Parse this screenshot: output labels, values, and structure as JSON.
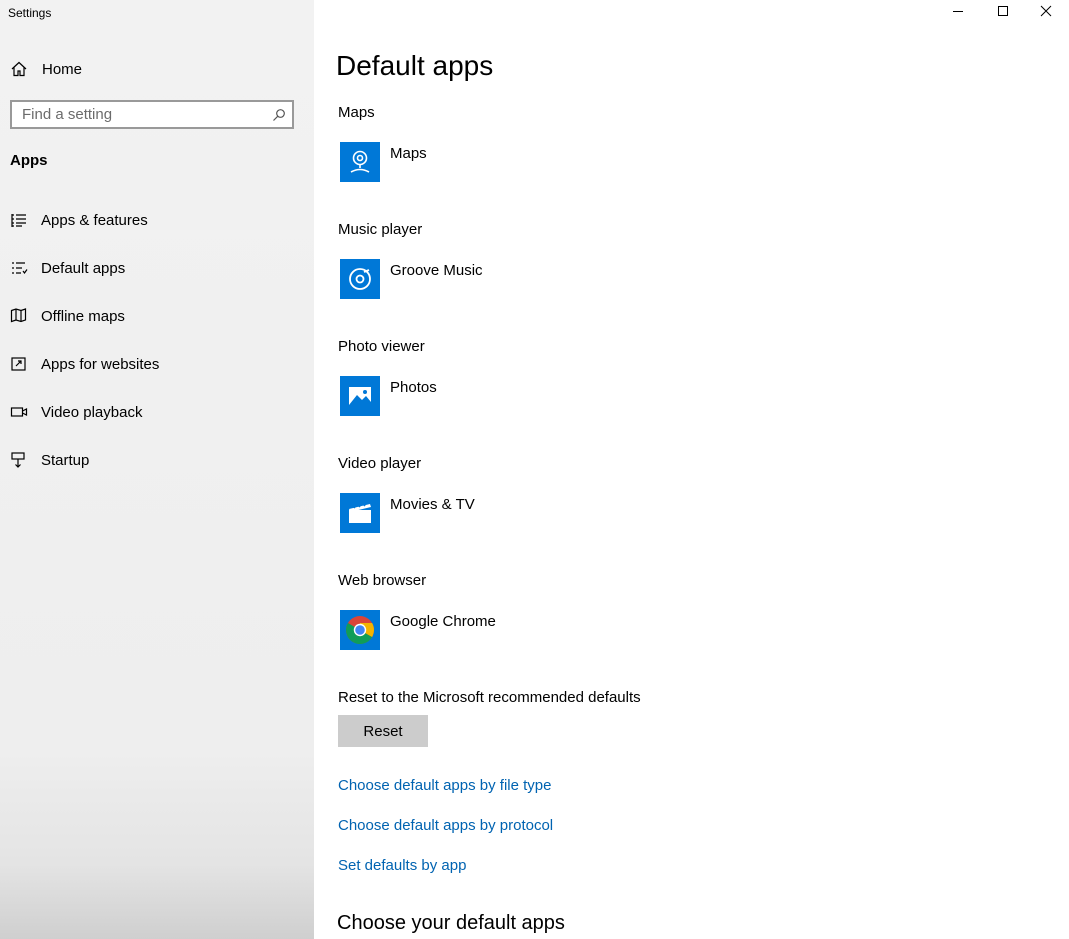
{
  "window": {
    "title": "Settings",
    "controls": [
      {
        "name": "minimize-button",
        "icon": "minimize-icon"
      },
      {
        "name": "maximize-button",
        "icon": "maximize-icon"
      },
      {
        "name": "close-button",
        "icon": "close-icon"
      }
    ]
  },
  "sidebar": {
    "home_label": "Home",
    "search_placeholder": "Find a setting",
    "section": "Apps",
    "items": [
      {
        "label": "Apps & features",
        "icon": "list-icon"
      },
      {
        "label": "Default apps",
        "icon": "default-apps-icon"
      },
      {
        "label": "Offline maps",
        "icon": "offline-maps-icon"
      },
      {
        "label": "Apps for websites",
        "icon": "apps-for-websites-icon"
      },
      {
        "label": "Video playback",
        "icon": "video-playback-icon"
      },
      {
        "label": "Startup",
        "icon": "startup-icon"
      }
    ]
  },
  "main": {
    "title": "Default apps",
    "groups": [
      {
        "label": "Maps",
        "app": "Maps",
        "icon": "maps-app-icon"
      },
      {
        "label": "Music player",
        "app": "Groove Music",
        "icon": "groove-music-icon"
      },
      {
        "label": "Photo viewer",
        "app": "Photos",
        "icon": "photos-icon"
      },
      {
        "label": "Video player",
        "app": "Movies & TV",
        "icon": "movies-tv-icon"
      },
      {
        "label": "Web browser",
        "app": "Google Chrome",
        "icon": "chrome-icon"
      }
    ],
    "reset_label": "Reset to the Microsoft recommended defaults",
    "reset_button": "Reset",
    "links": [
      "Choose default apps by file type",
      "Choose default apps by protocol",
      "Set defaults by app"
    ],
    "subheading": "Choose your default apps"
  },
  "colors": {
    "accent": "#0078d7",
    "link": "#0063b1",
    "sidebar_bg": "#f2f2f2",
    "button_bg": "#cccccc"
  }
}
